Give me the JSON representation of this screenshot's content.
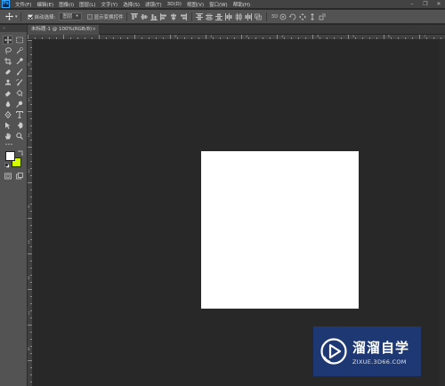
{
  "app": {
    "logo_text": "Ps"
  },
  "menubar": {
    "items": [
      "文件(F)",
      "编辑(E)",
      "图像(I)",
      "图层(L)",
      "文字(Y)",
      "选择(S)",
      "滤镜(T)",
      "3D(D)",
      "视图(V)",
      "窗口(W)",
      "帮助(H)"
    ],
    "window_controls": [
      "minimize-icon",
      "restore-icon",
      "close-icon"
    ]
  },
  "options_bar": {
    "auto_select_label": "自动选择:",
    "auto_select_checked": true,
    "auto_select_mode": "图层",
    "show_transform_label": "显示变换控件",
    "show_transform_checked": false
  },
  "document_tab": {
    "title": "未标题-1 @ 100%(RGB/8)",
    "close_glyph": "×"
  },
  "toolbox": {
    "header_glyph": "»",
    "more_glyph": "•••",
    "foreground_color": "#ffffff",
    "background_color": "#d4ff00"
  },
  "ruler_labels": {
    "horizontal": [
      "0",
      "1",
      "2",
      "3",
      "4",
      "5",
      "6",
      "7",
      "8",
      "9",
      "10"
    ],
    "vertical": [
      "0",
      "1",
      "2",
      "3",
      "4",
      "5",
      "6",
      "7",
      "8"
    ]
  },
  "document": {
    "fill_color": "#ffffff"
  },
  "watermark": {
    "brand_cn": "溜溜自学",
    "url": "ZIXUE.3D66.COM"
  }
}
